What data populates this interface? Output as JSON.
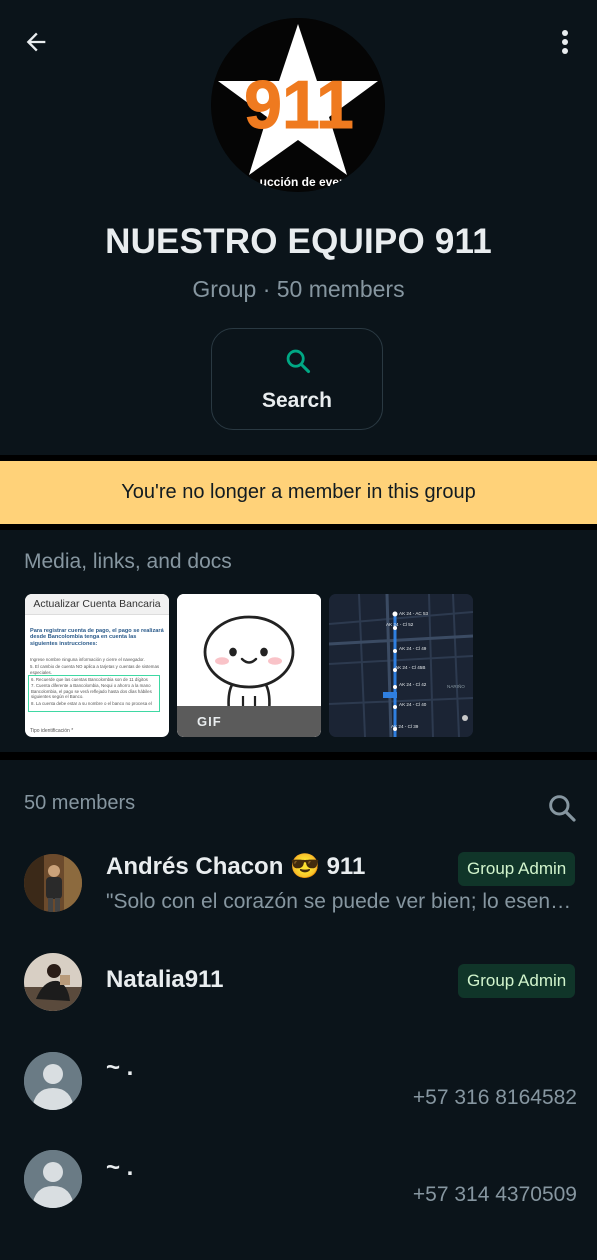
{
  "header": {
    "back_icon": "arrow-left-icon",
    "menu_icon": "more-vertical-icon"
  },
  "group": {
    "logo_number": "911",
    "logo_text": "ucción de even",
    "name": "NUESTRO EQUIPO 911",
    "subtitle": "Group · 50 members"
  },
  "search_card": {
    "icon": "search-icon",
    "label": "Search",
    "accent": "#00a884"
  },
  "notice": {
    "text": "You're no longer a member in this group",
    "background": "#ffd279"
  },
  "media": {
    "title": "Media, links, and docs",
    "items": [
      {
        "type": "document",
        "doc_title": "Actualizar Cuenta Bancaria",
        "doc_heading": "Para registrar cuenta de pago, el pago se realizará desde Bancolombia tenga en cuenta las siguientes instrucciones:",
        "doc_lines": [
          "Ingrese nombre ninguna información y cierre el navegador.",
          "5. El cambio de cuenta NO aplica a tarjetas y cuentas de sistemas especiales.",
          "6. Recuerde que las cuentas Bancolombia son de 11 dígitos",
          "7. Cuenta diferente a Bancolombia, Nequi o ahorro a la mano Bancolombia, el pago se verá reflejado hasta dos días hábiles siguientes según el Banco.",
          "8. La cuenta debe estar a su nombre o el banco no procesa el pago"
        ],
        "doc_footer": "Tipo identificación *"
      },
      {
        "type": "gif",
        "badge": "GIF"
      },
      {
        "type": "map",
        "labels": [
          "AK 24 - AC 53",
          "AK 24 - Cl 52",
          "AK 24 - Cl 49",
          "AK 24 - Cl 45B",
          "AK 24 - Cl 42",
          "AK 24 - Cl 40",
          "AK 24 - Cl 39",
          "NARIÑO"
        ]
      }
    ]
  },
  "members": {
    "count_label": "50 members",
    "search_icon": "search-icon",
    "list": [
      {
        "name": "Andrés Chacon 😎 911",
        "status": "\"Solo con el corazón se puede ver bien; lo esencial es invisible a los ojos\"",
        "badge": "Group Admin"
      },
      {
        "name": "Natalia911",
        "badge": "Group Admin"
      },
      {
        "name": "~ .",
        "phone": "+57 316 8164582"
      },
      {
        "name": "~ .",
        "phone": "+57 314 4370509"
      }
    ]
  }
}
